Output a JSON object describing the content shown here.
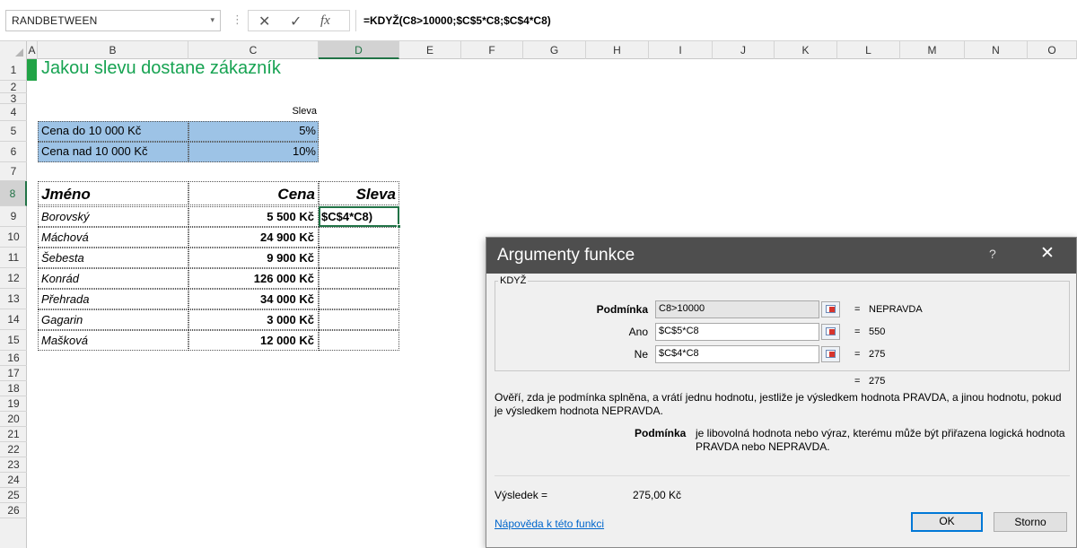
{
  "formula_bar": {
    "name_box": "RANDBETWEEN",
    "formula": "=KDYŽ(C8>10000;$C$5*C8;$C$4*C8)",
    "cancel_glyph": "✕",
    "enter_glyph": "✓",
    "fx_glyph": "fx",
    "separator_glyph": "⋮",
    "dropdown_glyph": "▾"
  },
  "columns": [
    "A",
    "B",
    "C",
    "D",
    "E",
    "F",
    "G",
    "H",
    "I",
    "J",
    "K",
    "L",
    "M",
    "N",
    "O"
  ],
  "rows": [
    "1",
    "2",
    "3",
    "4",
    "5",
    "6",
    "7",
    "8",
    "9",
    "10",
    "11",
    "12",
    "13",
    "14",
    "15",
    "16",
    "17",
    "18",
    "19",
    "20",
    "21",
    "22",
    "23",
    "24",
    "25",
    "26"
  ],
  "sheet": {
    "title": "Jakou slevu dostane zákazník",
    "discount_header": "Sleva",
    "discounts": [
      {
        "label": "Cena do 10 000 Kč",
        "value": "5%"
      },
      {
        "label": "Cena nad 10 000 Kč",
        "value": "10%"
      }
    ],
    "table_headers": {
      "name": "Jméno",
      "price": "Cena",
      "discount": "Sleva"
    },
    "customers": [
      {
        "name": "Borovský",
        "price": "5 500 Kč"
      },
      {
        "name": "Máchová",
        "price": "24 900 Kč"
      },
      {
        "name": "Šebesta",
        "price": "9 900 Kč"
      },
      {
        "name": "Konrád",
        "price": "126 000 Kč"
      },
      {
        "name": "Přehrada",
        "price": "34 000 Kč"
      },
      {
        "name": "Gagarin",
        "price": "3 000 Kč"
      },
      {
        "name": "Mašková",
        "price": "12 000 Kč"
      }
    ],
    "active_cell_text": "$C$4*C8)"
  },
  "dialog": {
    "title": "Argumenty funkce",
    "help_glyph": "?",
    "close_glyph": "✕",
    "function_name": "KDYŽ",
    "args": [
      {
        "label": "Podmínka",
        "value": "C8>10000",
        "result": "NEPRAVDA"
      },
      {
        "label": "Ano",
        "value": "$C$5*C8",
        "result": "550"
      },
      {
        "label": "Ne",
        "value": "$C$4*C8",
        "result": "275"
      }
    ],
    "eq_sign": "=",
    "overall_result": "275",
    "description": "Ověří, zda je podmínka splněna, a vrátí jednu hodnotu, jestliže je výsledkem hodnota PRAVDA, a jinou hodnotu, pokud je výsledkem hodnota NEPRAVDA.",
    "arg_desc_label": "Podmínka",
    "arg_desc_text": "je libovolná hodnota nebo výraz, kterému může být přiřazena logická hodnota PRAVDA nebo NEPRAVDA.",
    "result_label": "Výsledek =",
    "result_value": "275,00 Kč",
    "help_link": "Nápověda k této funkci",
    "ok_label": "OK",
    "cancel_label": "Storno"
  }
}
